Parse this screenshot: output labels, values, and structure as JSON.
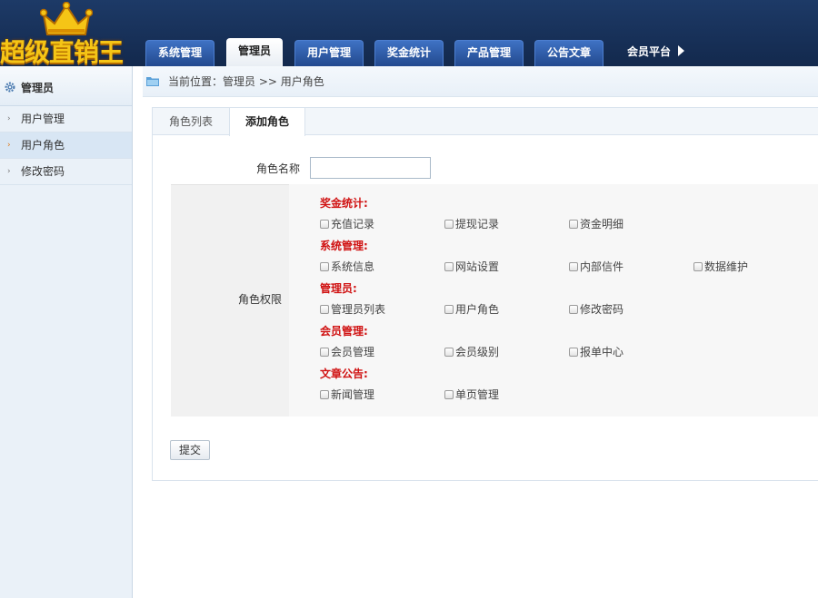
{
  "logo": {
    "text": "超级直销王"
  },
  "nav": {
    "tabs": [
      {
        "label": "系统管理"
      },
      {
        "label": "管理员"
      },
      {
        "label": "用户管理"
      },
      {
        "label": "奖金统计"
      },
      {
        "label": "产品管理"
      },
      {
        "label": "公告文章"
      }
    ],
    "active_index": 1,
    "member_platform": "会员平台"
  },
  "sidebar": {
    "title": "管理员",
    "items": [
      {
        "label": "用户管理"
      },
      {
        "label": "用户角色"
      },
      {
        "label": "修改密码"
      }
    ],
    "active_index": 1
  },
  "breadcrumb": {
    "text": "当前位置：管理员 >> 用户角色"
  },
  "panel": {
    "tabs": [
      {
        "label": "角色列表"
      },
      {
        "label": "添加角色"
      }
    ],
    "active_index": 1
  },
  "form": {
    "role_name_label": "角色名称",
    "role_name_value": "",
    "permissions_label": "角色权限",
    "groups": [
      {
        "title": "奖金统计:",
        "items": [
          "充值记录",
          "提现记录",
          "资金明细"
        ]
      },
      {
        "title": "系统管理:",
        "items": [
          "系统信息",
          "网站设置",
          "内部信件",
          "数据维护"
        ]
      },
      {
        "title": "管理员:",
        "items": [
          "管理员列表",
          "用户角色",
          "修改密码"
        ]
      },
      {
        "title": "会员管理:",
        "items": [
          "会员管理",
          "会员级别",
          "报单中心"
        ]
      },
      {
        "title": "文章公告:",
        "items": [
          "新闻管理",
          "单页管理"
        ]
      }
    ],
    "submit_label": "提交"
  },
  "colors": {
    "header_bg": "#1d3a67",
    "nav_tab": "#2f5fae",
    "group_title": "#d01212",
    "logo": "#f5c516"
  }
}
